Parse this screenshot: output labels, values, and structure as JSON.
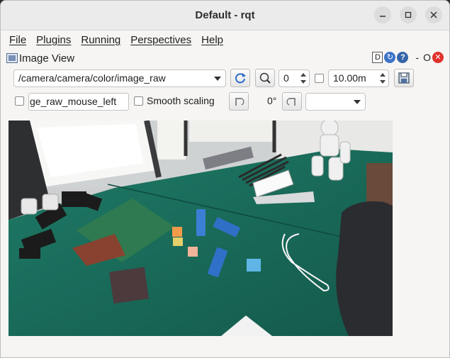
{
  "window": {
    "title": "Default - rqt",
    "min_icon": "minimize-icon",
    "max_icon": "maximize-icon",
    "close_icon": "close-icon"
  },
  "menu": [
    "File",
    "Plugins",
    "Running",
    "Perspectives",
    "Help"
  ],
  "panel": {
    "title": "Image View",
    "d_label": "D",
    "dash": "-",
    "o_label": "O"
  },
  "toolbar": {
    "topic": "/camera/camera/color/image_raw",
    "spin_value": "0",
    "max_range": "10.00m",
    "mouse_topic": "ge_raw_mouse_left",
    "smooth_label": "Smooth scaling",
    "rotation": "0°",
    "dropdown_value": ""
  },
  "colors": {
    "table": "#1d6b5b",
    "accent_blue": "#3d73c8"
  }
}
